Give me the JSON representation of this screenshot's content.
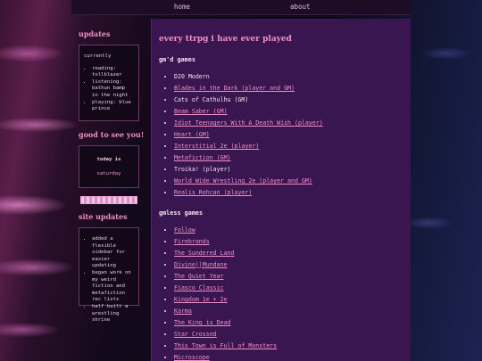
{
  "nav": {
    "home": "home",
    "about": "about"
  },
  "sidebar": {
    "updates_title": "updates",
    "status": {
      "heading": "currently",
      "items": [
        "reading: tollblazer",
        "listening: bathun bamp in the night",
        "playing: blue prince"
      ]
    },
    "greeting_title": "good to see you!",
    "greeting": {
      "label": "today is",
      "day": "saturday"
    },
    "site_updates_title": "site updates",
    "site_updates": [
      "added a flexible sidebar for easier updating",
      "began work on my weird fiction and metafiction rec lists",
      "half built a wrestling shrine"
    ]
  },
  "main": {
    "title": "every ttrpg i have ever played",
    "gmd_title": "gm'd games",
    "gmd_games": [
      {
        "label": "D20 Modern",
        "link": false
      },
      {
        "label": "Blades in the Dark (player and GM)",
        "link": true
      },
      {
        "label": "Cats of Cathulhu (GM)",
        "link": false
      },
      {
        "label": "Beam Saber (GM)",
        "link": true
      },
      {
        "label": "Idiot Teenagers With A Death Wish (player)",
        "link": true
      },
      {
        "label": "Heart (GM)",
        "link": true
      },
      {
        "label": "Interstitial 2e (player)",
        "link": true
      },
      {
        "label": "Metafiction (GM)",
        "link": true
      },
      {
        "label": "Troika! (player)",
        "link": false
      },
      {
        "label": "World Wide Wrestling 2e (player and GM)",
        "link": true
      },
      {
        "label": "Realis Rohcan (player)",
        "link": true
      }
    ],
    "gmless_title": "gmless games",
    "gmless_games": [
      {
        "label": "Follow",
        "link": true
      },
      {
        "label": "Firebrands",
        "link": true
      },
      {
        "label": "The Sundered Land",
        "link": true
      },
      {
        "label": "Divine||Mundane",
        "link": true
      },
      {
        "label": "The Quiet Year",
        "link": true
      },
      {
        "label": "Fiasco Classic",
        "link": true
      },
      {
        "label": "Kingdom 1e + 2e",
        "link": true
      },
      {
        "label": "Karma",
        "link": true
      },
      {
        "label": "The King is Dead",
        "link": true
      },
      {
        "label": "Star Crossed",
        "link": true
      },
      {
        "label": "This Town is Full of Monsters",
        "link": true
      },
      {
        "label": "Microscope",
        "link": true
      }
    ]
  },
  "colors": {
    "accent": "#f08fc6",
    "content_bg": "#3a1650",
    "box_bg": "#120817",
    "topbar_bg": "#1d0d24"
  }
}
